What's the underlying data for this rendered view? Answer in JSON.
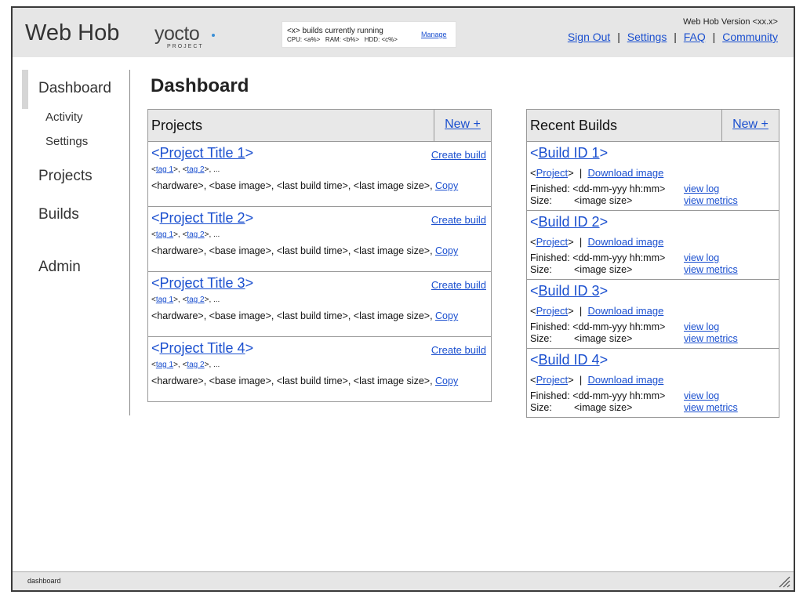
{
  "header": {
    "app_title": "Web Hob",
    "logo": {
      "word": "yocto",
      "sub": "PROJECT"
    },
    "status": {
      "line1": "<x> builds currently running",
      "cpu": "CPU: <a%>",
      "ram": "RAM: <b%>",
      "hdd": "HDD: <c%>",
      "manage": "Manage"
    },
    "version": "Web Hob Version <xx.x>",
    "links": {
      "sign_out": "Sign Out",
      "settings": "Settings",
      "faq": "FAQ",
      "community": "Community",
      "separator": "|"
    }
  },
  "sidebar": {
    "items": [
      {
        "label": "Dashboard"
      },
      {
        "label": "Activity"
      },
      {
        "label": "Settings"
      },
      {
        "label": "Projects"
      },
      {
        "label": "Builds"
      },
      {
        "label": "Admin"
      }
    ]
  },
  "main": {
    "page_title": "Dashboard",
    "projects": {
      "heading": "Projects",
      "new_label": "New +",
      "items": [
        {
          "title": "Project Title 1",
          "create": "Create build",
          "tag1": "tag 1",
          "tag2": "tag 2",
          "tags_more": ", ...",
          "info": "<hardware>, <base image>, <last build time>, <last image size>, ",
          "copy": "Copy"
        },
        {
          "title": "Project Title 2",
          "create": "Create build",
          "tag1": "tag 1",
          "tag2": "tag 2",
          "tags_more": ", ...",
          "info": "<hardware>, <base image>, <last build time>, <last image size>, ",
          "copy": "Copy"
        },
        {
          "title": "Project Title 3",
          "create": "Create build",
          "tag1": "tag 1",
          "tag2": "tag 2",
          "tags_more": ", ...",
          "info": "<hardware>, <base image>, <last build time>, <last image size>, ",
          "copy": "Copy"
        },
        {
          "title": "Project Title 4",
          "create": "Create build",
          "tag1": "tag 1",
          "tag2": "tag 2",
          "tags_more": ", ...",
          "info": "<hardware>, <base image>, <last build time>, <last image size>, ",
          "copy": "Copy"
        }
      ]
    },
    "builds": {
      "heading": "Recent Builds",
      "new_label": "New +",
      "items": [
        {
          "id": "Build ID 1",
          "project": "Project",
          "download": "Download image",
          "finished_label": "Finished:",
          "finished": "<dd-mm-yyy hh:mm>",
          "size_label": "Size:",
          "size": "<image size>",
          "view_log": "view log",
          "view_metrics": "view metrics"
        },
        {
          "id": "Build ID 2",
          "project": "Project",
          "download": "Download image",
          "finished_label": "Finished:",
          "finished": "<dd-mm-yyy hh:mm>",
          "size_label": "Size:",
          "size": "<image size>",
          "view_log": "view log",
          "view_metrics": "view metrics"
        },
        {
          "id": "Build ID 3",
          "project": "Project",
          "download": "Download image",
          "finished_label": "Finished:",
          "finished": "<dd-mm-yyy hh:mm>",
          "size_label": "Size:",
          "size": "<image size>",
          "view_log": "view log",
          "view_metrics": "view metrics"
        },
        {
          "id": "Build ID 4",
          "project": "Project",
          "download": "Download image",
          "finished_label": "Finished:",
          "finished": "<dd-mm-yyy hh:mm>",
          "size_label": "Size:",
          "size": "<image size>",
          "view_log": "view log",
          "view_metrics": "view metrics"
        }
      ]
    }
  },
  "statusbar": {
    "text": "dashboard"
  },
  "icons": {
    "logo_dot_color": "#3b8fd6",
    "resize_grip": "resize-grip-icon"
  }
}
